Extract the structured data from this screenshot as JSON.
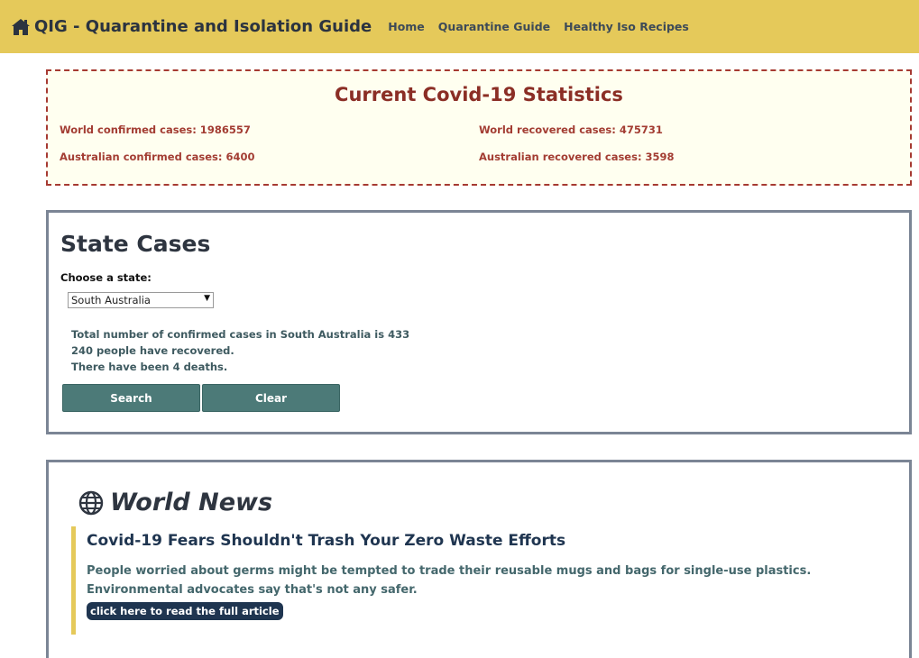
{
  "nav": {
    "brand": "QIG - Quarantine and Isolation Guide",
    "links": [
      "Home",
      "Quarantine Guide",
      "Healthy Iso Recipes"
    ]
  },
  "stats": {
    "title": "Current Covid-19 Statistics",
    "world_confirmed": "World confirmed cases: 1986557",
    "world_recovered": "World recovered cases: 475731",
    "au_confirmed": "Australian confirmed cases: 6400",
    "au_recovered": "Australian recovered cases: 3598"
  },
  "state": {
    "title": "State Cases",
    "label": "Choose a state:",
    "selected": "South Australia",
    "info": [
      "Total number of confirmed cases in South Australia is 433",
      "240 people have recovered.",
      "There have been 4 deaths."
    ],
    "search_label": "Search",
    "clear_label": "Clear"
  },
  "news": {
    "title": "World News",
    "article": {
      "title": "Covid-19 Fears Shouldn't Trash Your Zero Waste Efforts",
      "description": "People worried about germs might be tempted to trade their reusable mugs and bags for single-use plastics. Environmental advocates say that's not any safer.",
      "link_label": "click here to read the full article"
    }
  },
  "icons": {
    "brand": "home-icon",
    "news": "globe-icon"
  },
  "colors": {
    "navbar": "#e5c95a",
    "stats_text": "#a33d33",
    "button": "#4c7a78",
    "article_button": "#1f3550"
  }
}
